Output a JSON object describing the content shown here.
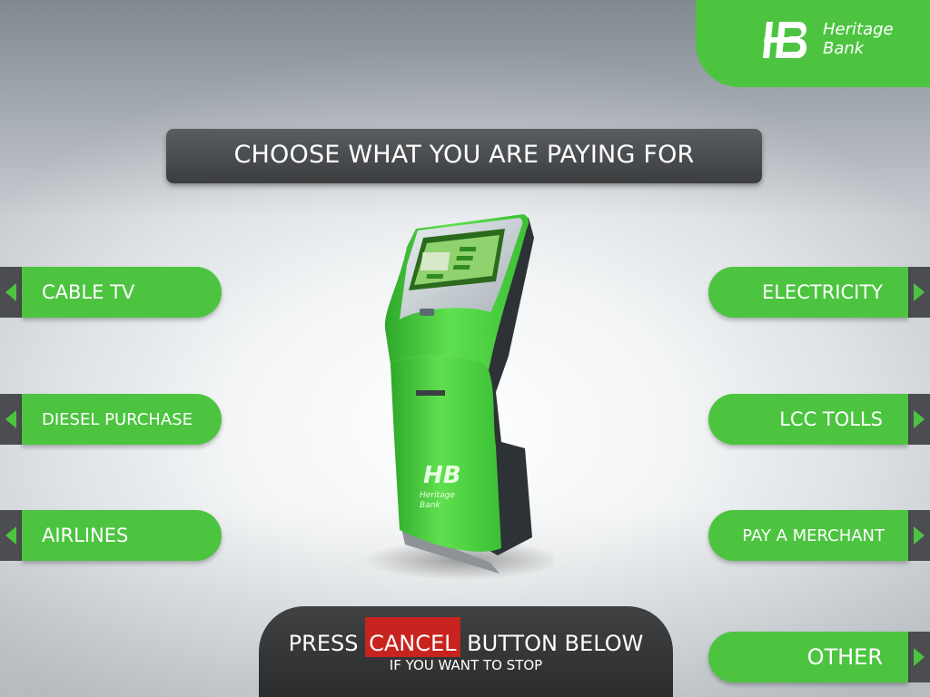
{
  "brand": {
    "name_line1": "Heritage",
    "name_line2": "Bank",
    "color": "#4cc440"
  },
  "title": "CHOOSE WHAT YOU ARE PAYING FOR",
  "options_left": [
    {
      "label": "CABLE TV"
    },
    {
      "label": "DIESEL PURCHASE"
    },
    {
      "label": "AIRLINES"
    }
  ],
  "options_right": [
    {
      "label": "ELECTRICITY"
    },
    {
      "label": "LCC TOLLS"
    },
    {
      "label": "PAY A MERCHANT"
    },
    {
      "label": "OTHER"
    }
  ],
  "cancel": {
    "line1_prefix": "PRESS",
    "line1_highlight": "CANCEL",
    "line1_suffix": "BUTTON BELOW",
    "line2": "IF YOU WANT TO STOP",
    "highlight_color": "#c8231e"
  },
  "kiosk_image": {
    "brand_line1": "Heritage",
    "brand_line2": "Bank"
  }
}
